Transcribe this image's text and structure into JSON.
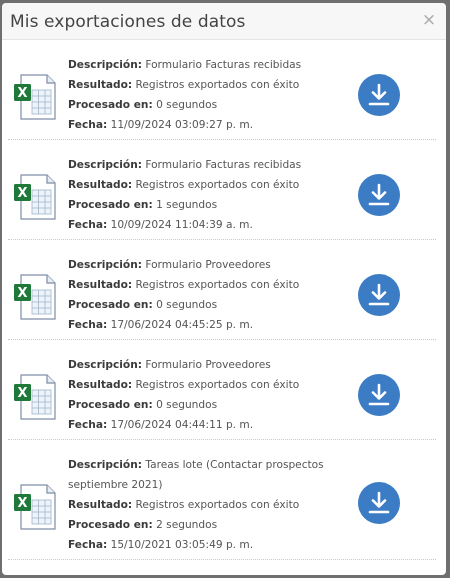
{
  "modal": {
    "title": "Mis exportaciones de datos",
    "close_glyph": "×"
  },
  "labels": {
    "descripcion": "Descripción:",
    "resultado": "Resultado:",
    "procesado": "Procesado en:",
    "fecha": "Fecha:"
  },
  "exports": [
    {
      "descripcion": "Formulario Facturas recibidas",
      "resultado": "Registros exportados con éxito",
      "procesado": "0 segundos",
      "fecha": "11/09/2024 03:09:27 p. m.",
      "icon": "excel-file-icon",
      "action_icon": "download-icon"
    },
    {
      "descripcion": "Formulario Facturas recibidas",
      "resultado": "Registros exportados con éxito",
      "procesado": "1 segundos",
      "fecha": "10/09/2024 11:04:39 a. m.",
      "icon": "excel-file-icon",
      "action_icon": "download-icon"
    },
    {
      "descripcion": "Formulario Proveedores",
      "resultado": "Registros exportados con éxito",
      "procesado": "0 segundos",
      "fecha": "17/06/2024 04:45:25 p. m.",
      "icon": "excel-file-icon",
      "action_icon": "download-icon"
    },
    {
      "descripcion": "Formulario Proveedores",
      "resultado": "Registros exportados con éxito",
      "procesado": "0 segundos",
      "fecha": "17/06/2024 04:44:11 p. m.",
      "icon": "excel-file-icon",
      "action_icon": "download-icon"
    },
    {
      "descripcion": "Tareas lote (Contactar prospectos septiembre 2021)",
      "resultado": "Registros exportados con éxito",
      "procesado": "2 segundos",
      "fecha": "15/10/2021 03:05:49 p. m.",
      "icon": "excel-file-icon",
      "action_icon": "download-icon"
    }
  ],
  "colors": {
    "download_button": "#3b7cc4",
    "excel_green": "#1f7a3a",
    "backdrop": "#6f6f6f"
  }
}
